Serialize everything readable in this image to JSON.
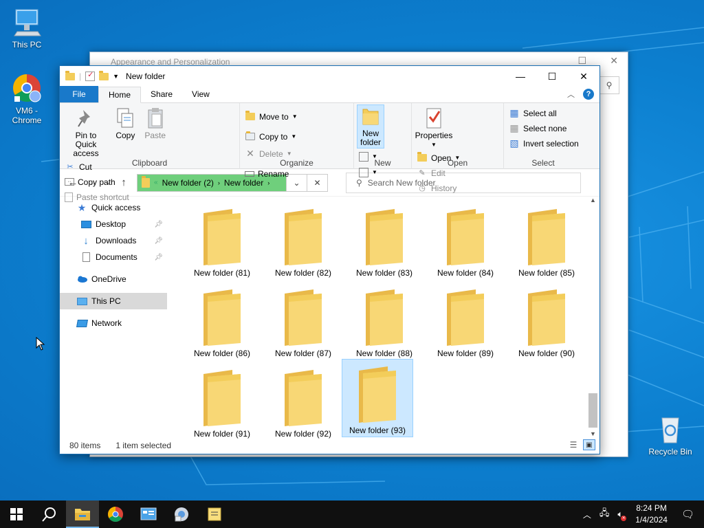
{
  "desktop": {
    "icons": [
      {
        "label": "This PC"
      },
      {
        "label": "VM6 -\nChrome"
      },
      {
        "label": "Recycle Bin"
      }
    ]
  },
  "background_window": {
    "title": "Appearance and Personalization"
  },
  "explorer": {
    "title": "New folder",
    "tabs": {
      "file": "File",
      "home": "Home",
      "share": "Share",
      "view": "View"
    },
    "ribbon": {
      "clipboard": {
        "pin": "Pin to Quick\naccess",
        "copy": "Copy",
        "paste": "Paste",
        "cut": "Cut",
        "copy_path": "Copy path",
        "paste_shortcut": "Paste shortcut",
        "label": "Clipboard"
      },
      "organize": {
        "move_to": "Move to",
        "copy_to": "Copy to",
        "delete": "Delete",
        "rename": "Rename",
        "label": "Organize"
      },
      "new": {
        "new_folder": "New\nfolder",
        "label": "New"
      },
      "open": {
        "properties": "Properties",
        "open": "Open",
        "edit": "Edit",
        "history": "History",
        "label": "Open"
      },
      "select": {
        "select_all": "Select all",
        "select_none": "Select none",
        "invert": "Invert selection",
        "label": "Select"
      }
    },
    "address": {
      "crumbs": [
        "New folder (2)",
        "New folder"
      ]
    },
    "search": {
      "placeholder": "Search New folder"
    },
    "nav": {
      "quick_access": "Quick access",
      "desktop": "Desktop",
      "downloads": "Downloads",
      "documents": "Documents",
      "onedrive": "OneDrive",
      "this_pc": "This PC",
      "network": "Network"
    },
    "folders": [
      "New folder (81)",
      "New folder (82)",
      "New folder (83)",
      "New folder (84)",
      "New folder (85)",
      "New folder (86)",
      "New folder (87)",
      "New folder (88)",
      "New folder (89)",
      "New folder (90)",
      "New folder (91)",
      "New folder (92)",
      "New folder (93)"
    ],
    "selected_folder_index": 12,
    "status": {
      "count": "80 items",
      "selection": "1 item selected"
    }
  },
  "taskbar": {
    "time": "8:24 PM",
    "date": "1/4/2024"
  },
  "colors": {
    "accent": "#1979ca",
    "address_highlight": "#6fcf7c",
    "selection": "#cce8ff",
    "folder": "#f3cd5a"
  }
}
